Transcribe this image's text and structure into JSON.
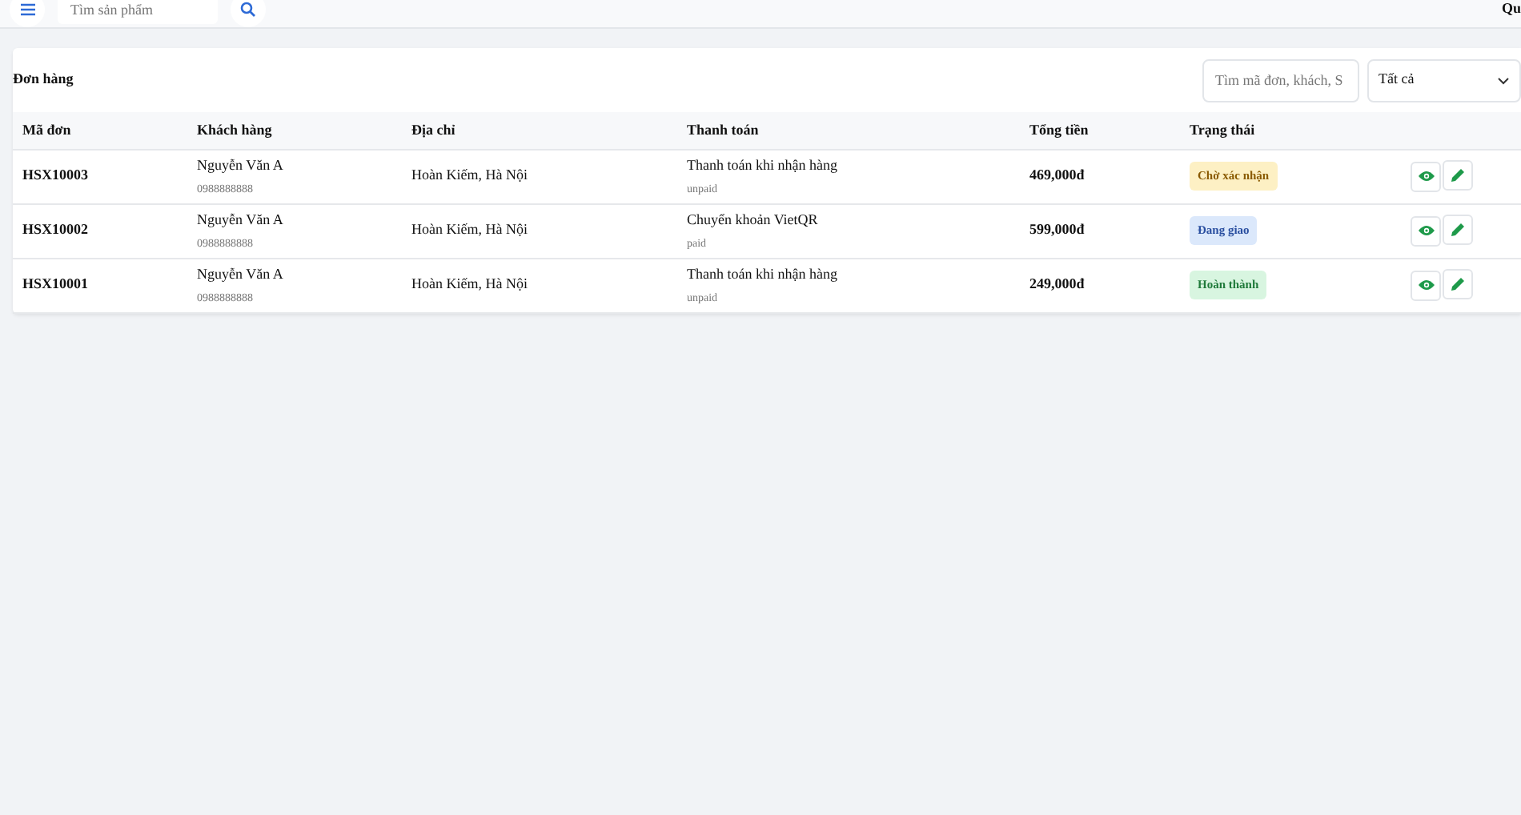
{
  "topbar": {
    "search": {
      "placeholder": "Tìm sản phẩm"
    },
    "right_text": "Qu"
  },
  "orders": {
    "title": "Đơn hàng",
    "search": {
      "placeholder": "Tìm mã đơn, khách, S"
    },
    "filter": {
      "value": "Tất cả"
    },
    "columns": [
      "Mã đơn",
      "Khách hàng",
      "Địa chỉ",
      "Thanh toán",
      "Tổng tiền",
      "Trạng thái"
    ],
    "rows": [
      {
        "id": "HSX10003",
        "customer": "Nguyễn Văn A",
        "phone": "0988888888",
        "address": "Hoàn Kiếm, Hà Nội",
        "payment": "Thanh toán khi nhận hàng",
        "payment_status": "unpaid",
        "total": "469,000đ",
        "status": "Chờ xác nhận",
        "kind": "pending"
      },
      {
        "id": "HSX10002",
        "customer": "Nguyễn Văn A",
        "phone": "0988888888",
        "address": "Hoàn Kiếm, Hà Nội",
        "payment": "Chuyển khoản VietQR",
        "payment_status": "paid",
        "total": "599,000đ",
        "status": "Đang giao",
        "kind": "shipping"
      },
      {
        "id": "HSX10001",
        "customer": "Nguyễn Văn A",
        "phone": "0988888888",
        "address": "Hoàn Kiếm, Hà Nội",
        "payment": "Thanh toán khi nhận hàng",
        "payment_status": "unpaid",
        "total": "249,000đ",
        "status": "Hoàn thành",
        "kind": "done"
      }
    ]
  }
}
